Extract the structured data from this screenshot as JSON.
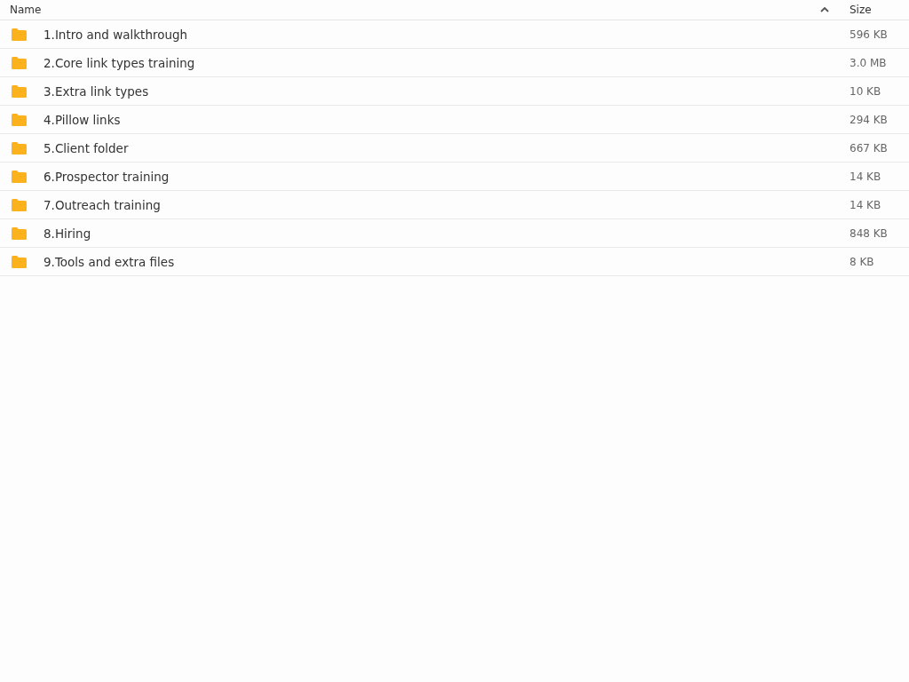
{
  "table": {
    "columns": [
      {
        "label": "Name",
        "sorted": true
      },
      {
        "label": "Size",
        "sorted": false
      }
    ],
    "rows": [
      {
        "name": "1.Intro and walkthrough",
        "size": "596 KB"
      },
      {
        "name": "2.Core link types training",
        "size": "3.0 MB"
      },
      {
        "name": "3.Extra link types",
        "size": "10 KB"
      },
      {
        "name": "4.Pillow links",
        "size": "294 KB"
      },
      {
        "name": "5.Client folder",
        "size": "667 KB"
      },
      {
        "name": "6.Prospector training",
        "size": "14 KB"
      },
      {
        "name": "7.Outreach training",
        "size": "14 KB"
      },
      {
        "name": "8.Hiring",
        "size": "848 KB"
      },
      {
        "name": "9.Tools and extra files",
        "size": "8 KB"
      }
    ]
  }
}
